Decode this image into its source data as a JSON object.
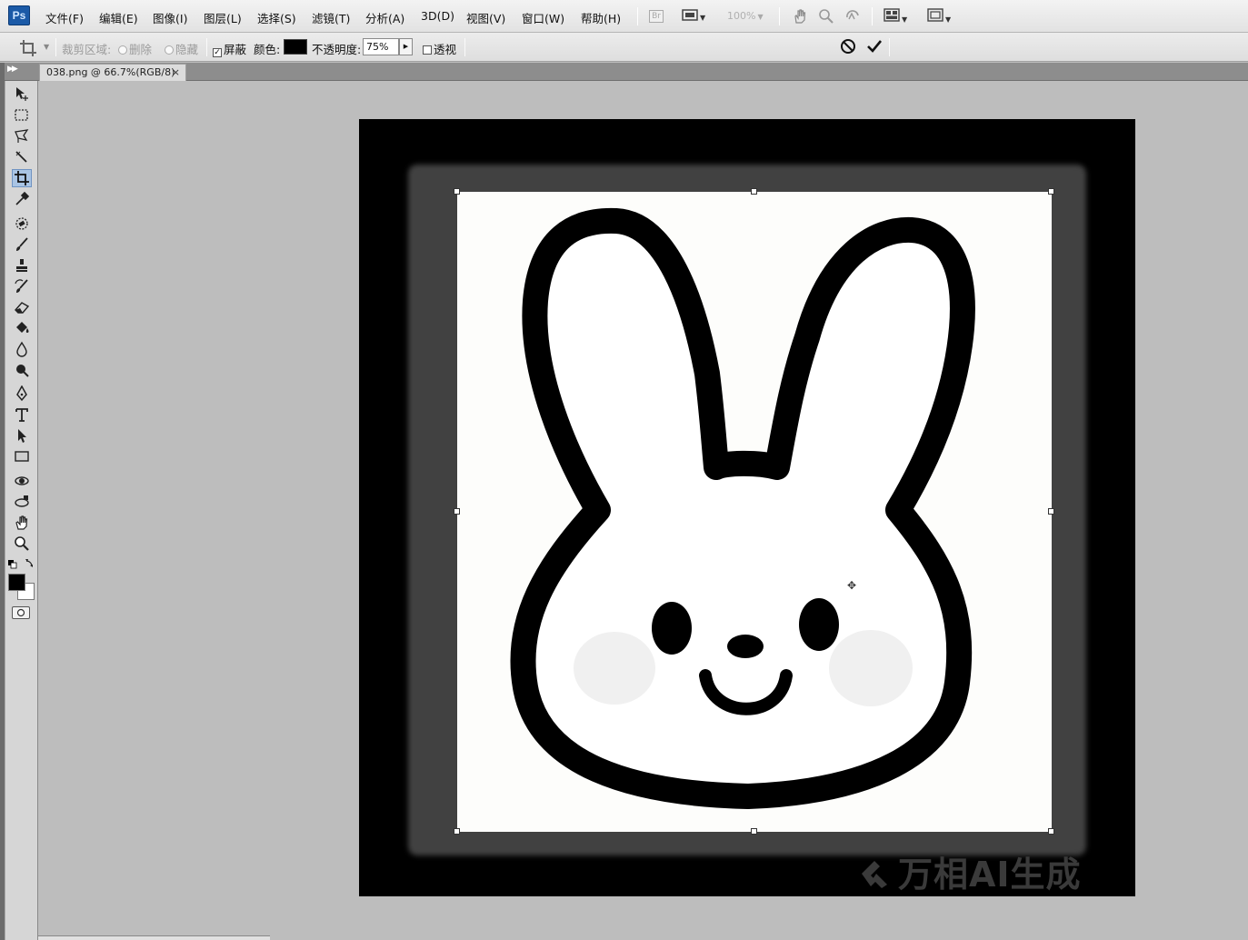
{
  "app": {
    "logo_text": "Ps"
  },
  "menu": {
    "items": [
      "文件(F)",
      "编辑(E)",
      "图像(I)",
      "图层(L)",
      "选择(S)",
      "滤镜(T)",
      "分析(A)",
      "3D(D)",
      "视图(V)",
      "窗口(W)",
      "帮助(H)"
    ],
    "bridge_badge": "Br",
    "zoom_level": "100%"
  },
  "options": {
    "crop_area_label": "裁剪区域:",
    "delete_label": "删除",
    "hide_label": "隐藏",
    "shield_label": "屏蔽",
    "shield_checked": true,
    "color_label": "颜色:",
    "shield_color": "#000000",
    "opacity_label": "不透明度:",
    "opacity_value": "75%",
    "perspective_label": "透视",
    "perspective_checked": false
  },
  "document": {
    "tab_title": "038.png @ 66.7%(RGB/8)",
    "close_glyph": "×"
  },
  "canvas": {
    "watermark": "万相AI生成",
    "shield_ring_color": "#414141",
    "crop_bg": "#fdfdfb"
  },
  "tools": [
    "move",
    "marquee",
    "lasso",
    "magic-wand",
    "crop",
    "eyedropper",
    "spot-healing",
    "brush",
    "clone-stamp",
    "history-brush",
    "eraser",
    "paint-bucket",
    "blur",
    "dodge",
    "pen",
    "type",
    "path-selection",
    "rectangle",
    "3d-rotate",
    "3d-orbit",
    "hand",
    "zoom"
  ],
  "active_tool": "crop",
  "colors": {
    "foreground": "#000000",
    "background": "#ffffff"
  }
}
